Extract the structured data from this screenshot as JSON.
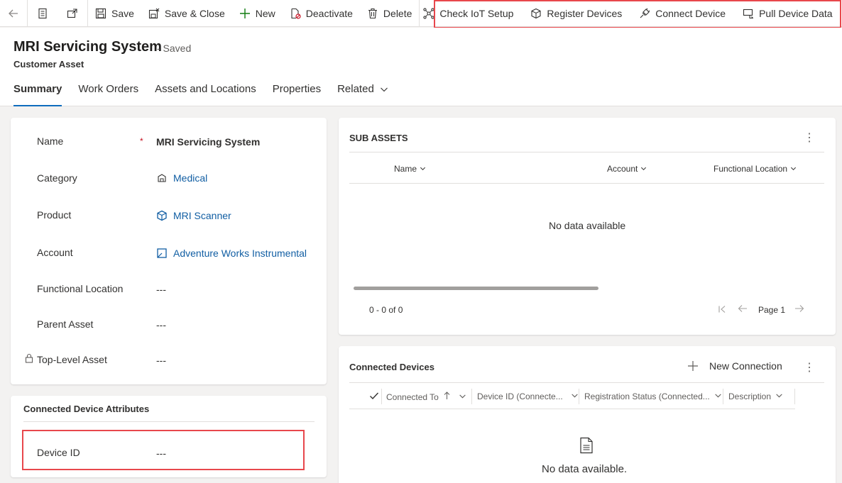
{
  "toolbar": {
    "save": "Save",
    "save_close": "Save & Close",
    "new": "New",
    "deactivate": "Deactivate",
    "delete": "Delete",
    "check_iot": "Check IoT Setup",
    "register": "Register Devices",
    "connect": "Connect Device",
    "pull": "Pull Device Data"
  },
  "header": {
    "title": "MRI Servicing System",
    "saved": "- Saved",
    "entity": "Customer Asset"
  },
  "tabs": [
    "Summary",
    "Work Orders",
    "Assets and Locations",
    "Properties",
    "Related"
  ],
  "form": {
    "name_label": "Name",
    "name_value": "MRI Servicing System",
    "category_label": "Category",
    "category_value": "Medical",
    "product_label": "Product",
    "product_value": "MRI Scanner",
    "account_label": "Account",
    "account_value": "Adventure Works Instrumental",
    "fl_label": "Functional Location",
    "fl_value": "---",
    "parent_label": "Parent Asset",
    "parent_value": "---",
    "top_label": "Top-Level Asset",
    "top_value": "---"
  },
  "cda": {
    "title": "Connected Device Attributes",
    "device_label": "Device ID",
    "device_value": "---"
  },
  "sub_assets": {
    "title": "SUB ASSETS",
    "col_name": "Name",
    "col_account": "Account",
    "col_fl": "Functional Location",
    "empty": "No data available",
    "count": "0 - 0 of 0",
    "page": "Page 1"
  },
  "connected": {
    "title": "Connected Devices",
    "new_connection": "New Connection",
    "col_connected": "Connected To",
    "col_device": "Device ID (Connecte...",
    "col_status": "Registration Status (Connected...",
    "col_desc": "Description",
    "empty": "No data available."
  },
  "colors": {
    "link": "#115ea3",
    "accent": "#0f6cbd",
    "highlight": "#e8474c",
    "required": "#c50f1f"
  }
}
